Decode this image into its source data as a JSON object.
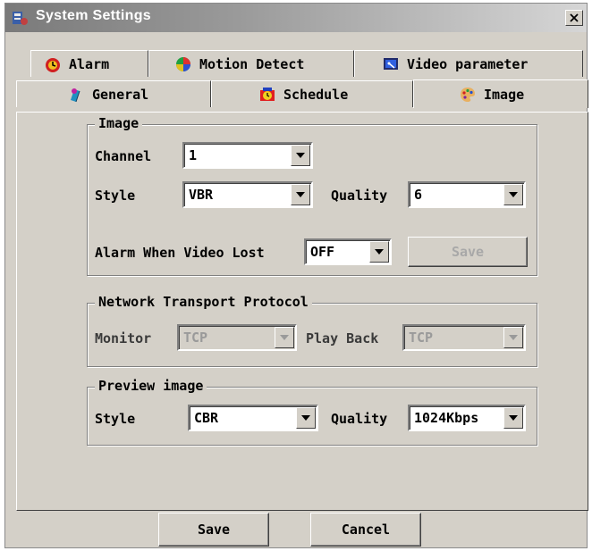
{
  "window": {
    "title": "System Settings",
    "close_glyph": "✕"
  },
  "tabs": {
    "row_back": [
      {
        "label": "Alarm",
        "icon": "alarm-icon"
      },
      {
        "label": "Motion Detect",
        "icon": "motion-detect-icon"
      },
      {
        "label": "Video parameter",
        "icon": "video-parameter-icon"
      }
    ],
    "row_front": [
      {
        "label": "General",
        "icon": "general-icon"
      },
      {
        "label": "Schedule",
        "icon": "schedule-icon"
      },
      {
        "label": "Image",
        "icon": "image-icon",
        "active": true
      }
    ]
  },
  "image_group": {
    "title": "Image",
    "channel_label": "Channel",
    "channel_value": "1",
    "style_label": "Style",
    "style_value": "VBR",
    "quality_label": "Quality",
    "quality_value": "6",
    "alarm_label": "Alarm When Video Lost",
    "alarm_value": "OFF",
    "save_label": "Save"
  },
  "network_group": {
    "title": "Network Transport Protocol",
    "monitor_label": "Monitor",
    "monitor_value": "TCP",
    "playback_label": "Play Back",
    "playback_value": "TCP"
  },
  "preview_group": {
    "title": "Preview image",
    "style_label": "Style",
    "style_value": "CBR",
    "quality_label": "Quality",
    "quality_value": "1024Kbps"
  },
  "footer": {
    "save_label": "Save",
    "cancel_label": "Cancel"
  },
  "colors": {
    "face": "#d4d0c8",
    "title_start": "#7a7a7a",
    "title_end": "#d6d6d6"
  }
}
